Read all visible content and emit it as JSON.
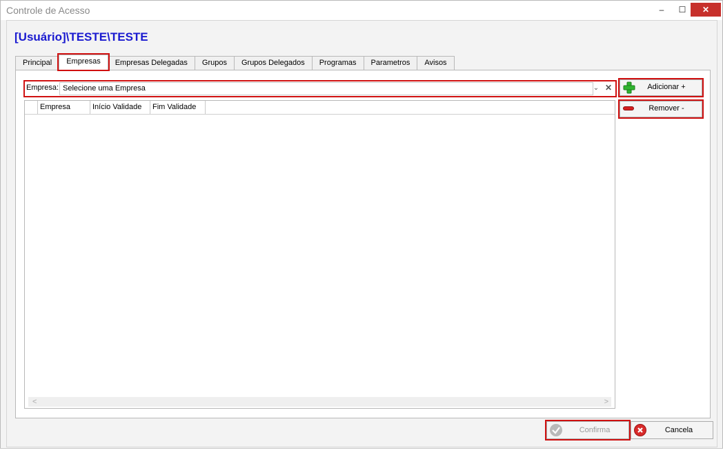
{
  "window": {
    "title": "Controle de Acesso",
    "minimize": "‒",
    "maximize": "☐",
    "close": "✕"
  },
  "user_header": "[Usuário]\\TESTE\\TESTE",
  "tabs": [
    {
      "label": "Principal"
    },
    {
      "label": "Empresas",
      "active": true
    },
    {
      "label": "Empresas Delegadas"
    },
    {
      "label": "Grupos"
    },
    {
      "label": "Grupos Delegados"
    },
    {
      "label": "Programas"
    },
    {
      "label": "Parametros"
    },
    {
      "label": "Avisos"
    }
  ],
  "filter": {
    "label": "Empresa:",
    "value": "Selecione uma Empresa",
    "dropdown_glyph": "⌄",
    "clear_glyph": "✕"
  },
  "grid": {
    "columns": [
      "Empresa",
      "Início Validade",
      "Fim Validade"
    ],
    "rows": [],
    "scroll_left": "<",
    "scroll_right": ">"
  },
  "actions": {
    "add_label": "Adicionar +",
    "remove_label": "Remover -"
  },
  "footer": {
    "confirm_label": "Confirma",
    "cancel_label": "Cancela"
  },
  "colors": {
    "header_blue": "#1a1ad0",
    "highlight_red": "#d01010",
    "add_green": "#2fb52f",
    "remove_red": "#d42020"
  }
}
